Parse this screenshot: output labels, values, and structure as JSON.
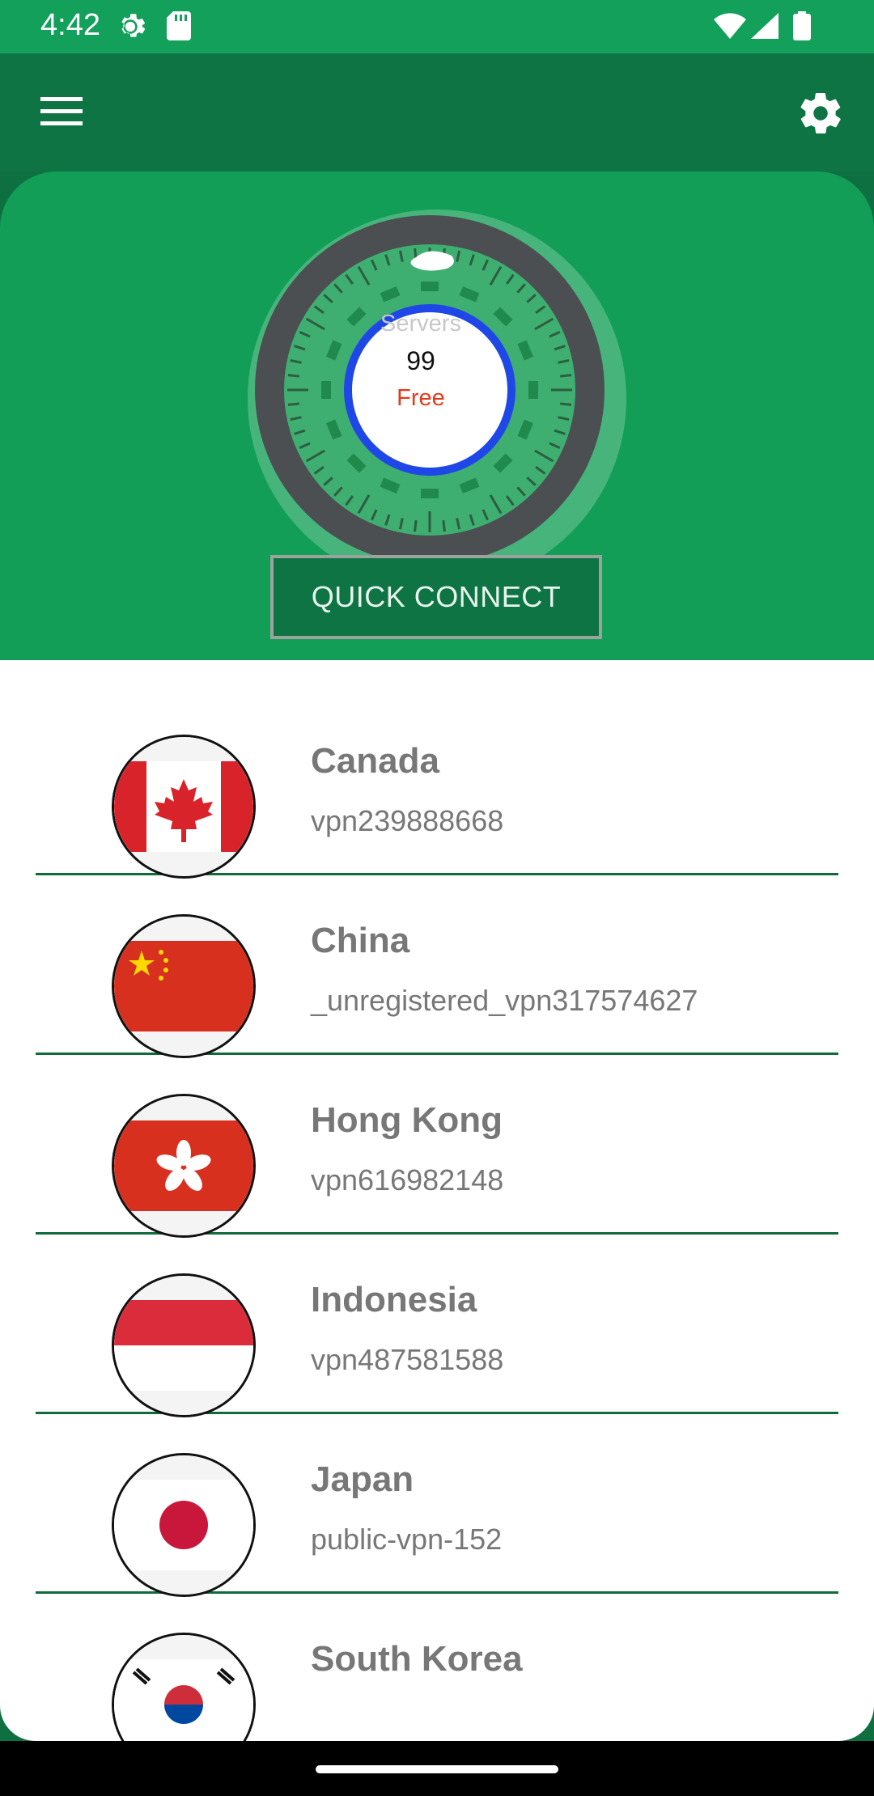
{
  "status_bar": {
    "time": "4:42",
    "icons": [
      "settings-gear-icon",
      "sd-card-icon",
      "wifi-icon",
      "signal-icon",
      "battery-icon"
    ]
  },
  "app_bar": {
    "menu_icon": "hamburger-menu-icon",
    "settings_icon": "gear-icon"
  },
  "hero": {
    "servers_label": "Servers",
    "servers_count": "99",
    "plan_label": "Free",
    "quick_connect_label": "QUICK CONNECT"
  },
  "servers": [
    {
      "country": "Canada",
      "host": "vpn239888668",
      "flag": "canada-flag-icon"
    },
    {
      "country": "China",
      "host": "_unregistered_vpn317574627",
      "flag": "china-flag-icon"
    },
    {
      "country": "Hong Kong",
      "host": "vpn616982148",
      "flag": "hong-kong-flag-icon"
    },
    {
      "country": "Indonesia",
      "host": "vpn487581588",
      "flag": "indonesia-flag-icon"
    },
    {
      "country": "Japan",
      "host": "public-vpn-152",
      "flag": "japan-flag-icon"
    },
    {
      "country": "South Korea",
      "host": "",
      "flag": "south-korea-flag-icon"
    }
  ],
  "colors": {
    "status_bar": "#12a05a",
    "app_bar": "#0e7444",
    "hero": "#139e58",
    "ring": "#4b4f52",
    "blue_ring": "#1f47e8",
    "plan_red": "#e23a1a",
    "divider": "#0f6a3c"
  }
}
